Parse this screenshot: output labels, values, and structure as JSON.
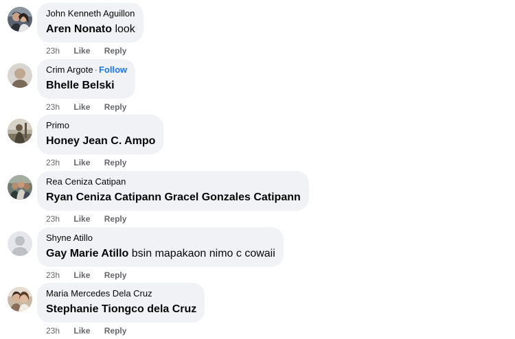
{
  "colors": {
    "bubble_bg": "#f0f2f5",
    "text_primary": "#050505",
    "text_secondary": "#65676b",
    "link_blue": "#1877f2"
  },
  "comments": [
    {
      "author": "John Kenneth Aguillon",
      "follow": "",
      "mention": "Aren Nonato",
      "text": "look",
      "time": "23h",
      "like_label": "Like",
      "reply_label": "Reply",
      "avatar_icon": "profile-photo-couple"
    },
    {
      "author": "Crim Argote",
      "follow": "Follow",
      "mention": "Bhelle Belski",
      "text": "",
      "time": "23h",
      "like_label": "Like",
      "reply_label": "Reply",
      "avatar_icon": "profile-photo-person"
    },
    {
      "author": "Primo",
      "follow": "",
      "mention": "Honey Jean C. Ampo",
      "text": "",
      "time": "23h",
      "like_label": "Like",
      "reply_label": "Reply",
      "avatar_icon": "profile-photo-outdoor"
    },
    {
      "author": "Rea Ceniza Catipan",
      "follow": "",
      "mention": "Ryan Ceniza Catipann Gracel Gonzales Catipann",
      "text": "",
      "time": "23h",
      "like_label": "Like",
      "reply_label": "Reply",
      "avatar_icon": "profile-photo-group"
    },
    {
      "author": "Shyne Atillo",
      "follow": "",
      "mention": "Gay Marie Atillo",
      "text": "bsin mapakaon nimo c cowaii",
      "time": "23h",
      "like_label": "Like",
      "reply_label": "Reply",
      "avatar_icon": "default-avatar-icon"
    },
    {
      "author": "Maria Mercedes Dela Cruz",
      "follow": "",
      "mention": "Stephanie Tiongco dela Cruz",
      "text": "",
      "time": "23h",
      "like_label": "Like",
      "reply_label": "Reply",
      "avatar_icon": "profile-photo-selfie"
    }
  ]
}
